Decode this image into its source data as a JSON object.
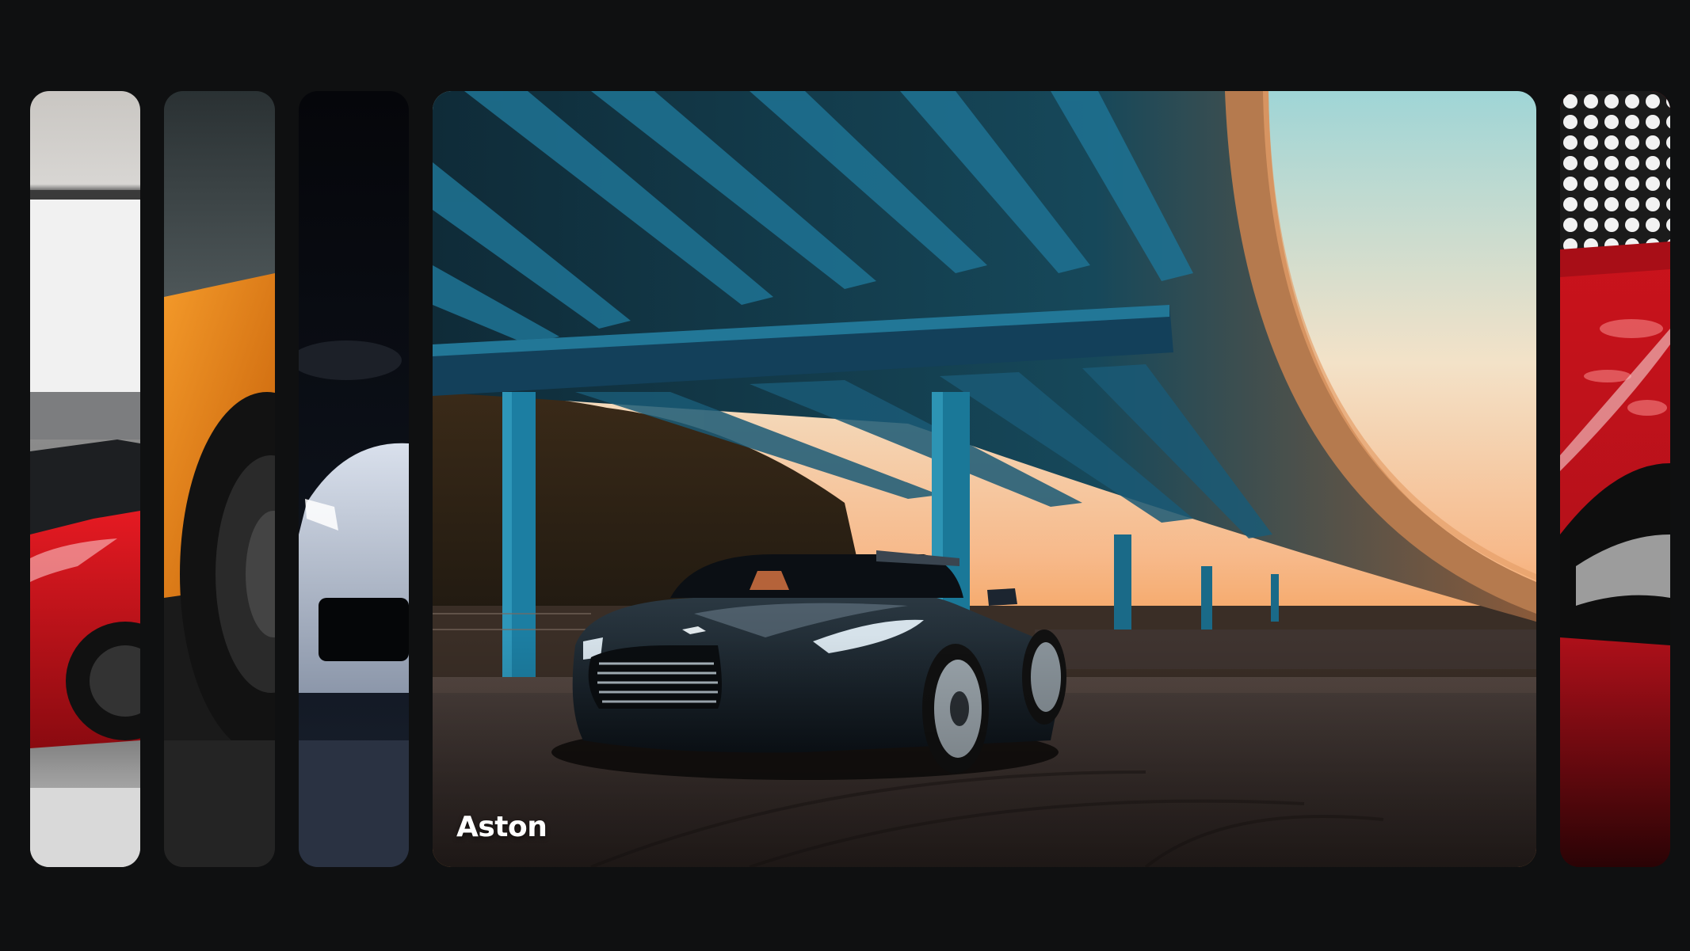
{
  "gallery": {
    "active_index": 3,
    "panels": [
      {
        "name": "red-supercar",
        "caption": "",
        "accent": "#d4141c"
      },
      {
        "name": "orange-lamborghini",
        "caption": "",
        "accent": "#f08a1c"
      },
      {
        "name": "silver-camaro",
        "caption": "",
        "accent": "#b8c4d6"
      },
      {
        "name": "aston",
        "caption": "Aston",
        "accent": "#1d7a97"
      },
      {
        "name": "red-sportscar",
        "caption": "",
        "accent": "#c0101c"
      }
    ]
  },
  "colors": {
    "background": "#0f1011",
    "caption_text": "#ffffff"
  }
}
